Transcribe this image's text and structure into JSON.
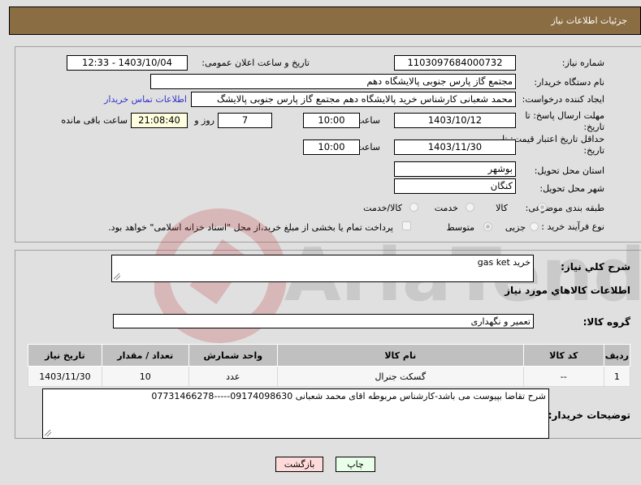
{
  "header": {
    "title": "جزئیات اطلاعات نیاز"
  },
  "form": {
    "need_number": {
      "label": "شماره نیاز:",
      "value": "1103097684000732"
    },
    "announce_datetime": {
      "label": "تاریخ و ساعت اعلان عمومی:",
      "value": "1403/10/04 - 12:33"
    },
    "buyer_org": {
      "label": "نام دستگاه خریدار:",
      "value": "مجتمع گاز پارس جنوبی  پالایشگاه دهم"
    },
    "requester": {
      "label": "ایجاد کننده درخواست:",
      "value": "محمد شعبانی کارشناس خرید پالایشگاه دهم  مجتمع گاز پارس جنوبی  پالایشگ",
      "contact_link": "اطلاعات تماس خریدار"
    },
    "response_deadline": {
      "label_line1": "مهلت ارسال پاسخ: تا",
      "label_line2": "تاریخ:",
      "date": "1403/10/12",
      "time_label": "ساعت",
      "time": "10:00",
      "days": "7",
      "days_label": "روز و",
      "remaining": "21:08:40",
      "remaining_label": "ساعت باقی مانده"
    },
    "price_validity": {
      "label_line1": "حداقل تاریخ اعتبار قیمت: تا",
      "label_line2": "تاریخ:",
      "date": "1403/11/30",
      "time_label": "ساعت",
      "time": "10:00"
    },
    "delivery_province": {
      "label": "استان محل تحویل:",
      "value": "بوشهر"
    },
    "delivery_city": {
      "label": "شهر محل تحویل:",
      "value": "کنگان"
    },
    "category": {
      "label": "طبقه بندی موضوعی:",
      "options": [
        "کالا",
        "خدمت",
        "کالا/خدمت"
      ],
      "selected": "کالا"
    },
    "purchase_type": {
      "label": "نوع فرآیند خرید :",
      "options": [
        "جزیی",
        "متوسط"
      ],
      "selected": "متوسط",
      "checkbox_label": "پرداخت تمام یا بخشی از مبلغ خرید،از محل \"اسناد خزانه اسلامی\" خواهد بود."
    }
  },
  "details": {
    "summary_label": "شرح کلي نياز:",
    "summary_value": "خرید gas ket",
    "goods_section_title": "اطلاعات کالاهاي مورد نياز",
    "goods_group_label": "گروه کالا:",
    "goods_group_value": "تعمیر و نگهداری"
  },
  "table": {
    "headers": [
      "ردیف",
      "کد کالا",
      "نام کالا",
      "واحد شمارش",
      "تعداد / مقدار",
      "تاریخ نیاز"
    ],
    "rows": [
      [
        "1",
        "--",
        "گسکت جنرال",
        "عدد",
        "10",
        "1403/11/30"
      ]
    ]
  },
  "buyer_notes": {
    "label": "توضیحات خریدار:",
    "value": "شرح تقاضا بپیوست می باشد-کارشناس مربوطه اقای محمد شعبانی 09174098630-----07731466278"
  },
  "buttons": {
    "print": "چاپ",
    "back": "بازگشت"
  },
  "watermark": "AriaTender.neT"
}
